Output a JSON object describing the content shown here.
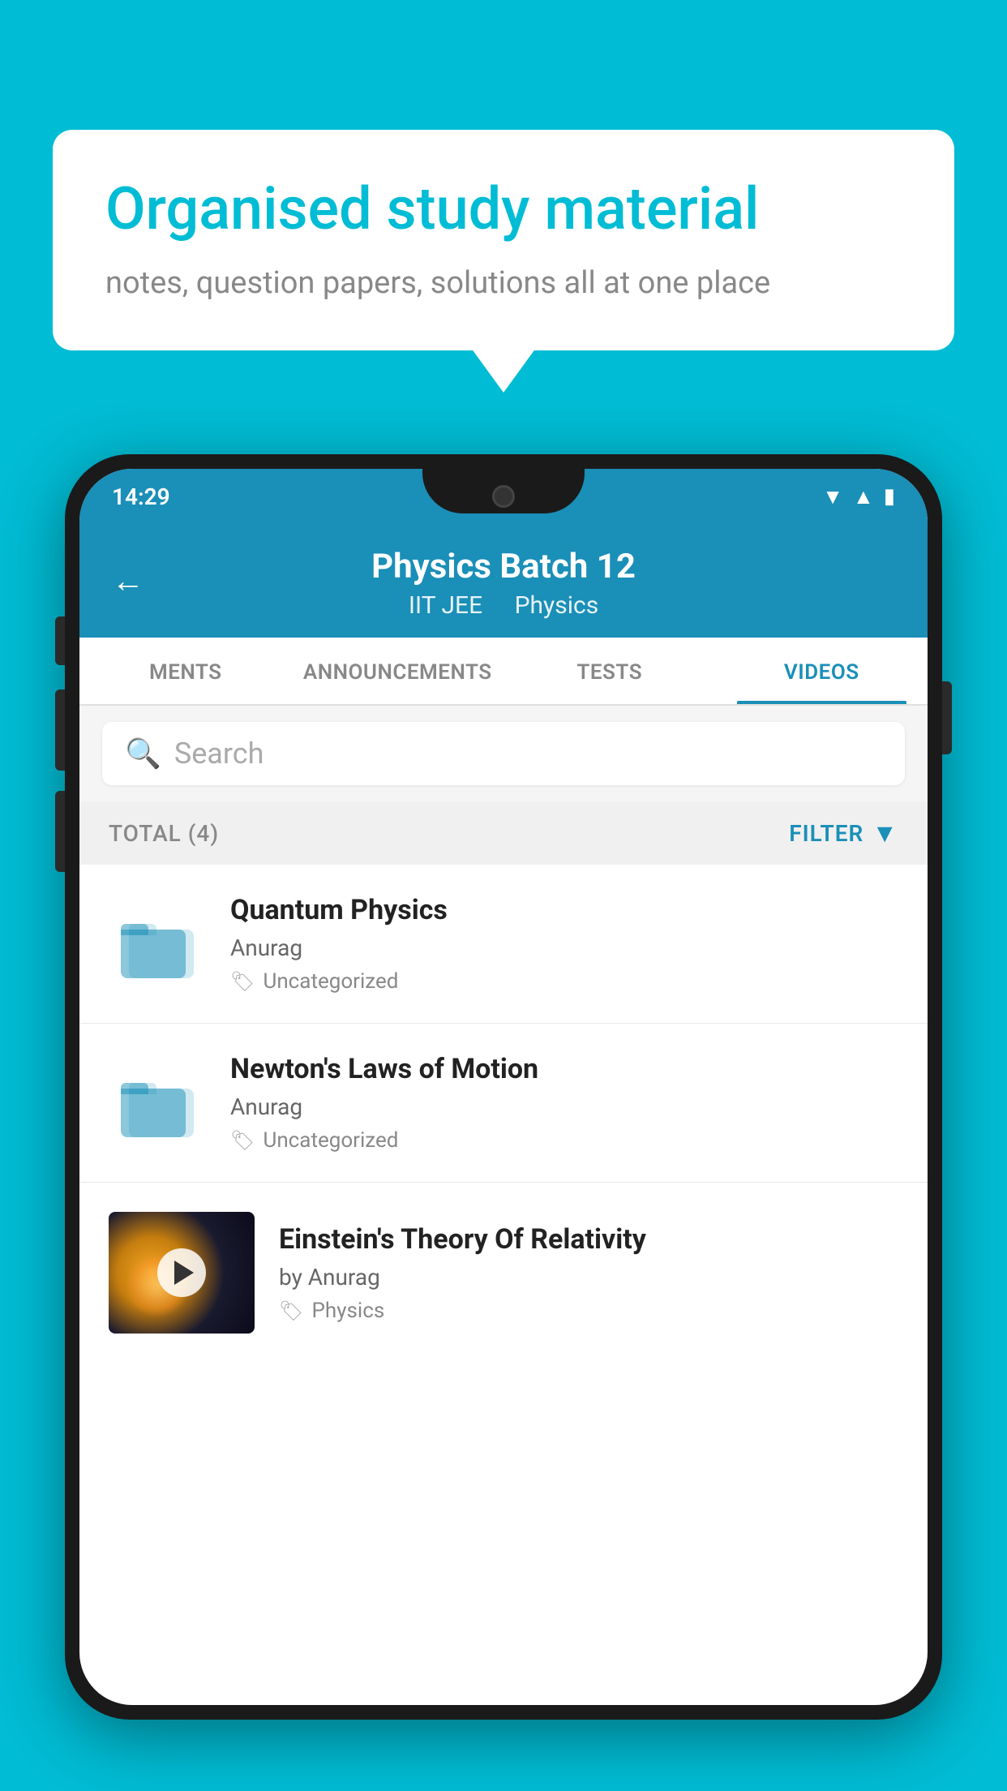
{
  "background": {
    "color": "#00bcd4"
  },
  "speech_bubble": {
    "title": "Organised study material",
    "subtitle": "notes, question papers, solutions all at one place"
  },
  "phone": {
    "status_bar": {
      "time": "14:29"
    },
    "header": {
      "title": "Physics Batch 12",
      "subtitle_part1": "IIT JEE",
      "subtitle_part2": "Physics",
      "back_label": "←"
    },
    "tabs": [
      {
        "label": "MENTS",
        "active": false
      },
      {
        "label": "ANNOUNCEMENTS",
        "active": false
      },
      {
        "label": "TESTS",
        "active": false
      },
      {
        "label": "VIDEOS",
        "active": true
      }
    ],
    "search": {
      "placeholder": "Search"
    },
    "filter_bar": {
      "total_label": "TOTAL (4)",
      "filter_label": "FILTER"
    },
    "videos": [
      {
        "id": 1,
        "title": "Quantum Physics",
        "author": "Anurag",
        "tag": "Uncategorized",
        "has_thumbnail": false
      },
      {
        "id": 2,
        "title": "Newton's Laws of Motion",
        "author": "Anurag",
        "tag": "Uncategorized",
        "has_thumbnail": false
      },
      {
        "id": 3,
        "title": "Einstein's Theory Of Relativity",
        "author": "by Anurag",
        "tag": "Physics",
        "has_thumbnail": true
      }
    ]
  }
}
